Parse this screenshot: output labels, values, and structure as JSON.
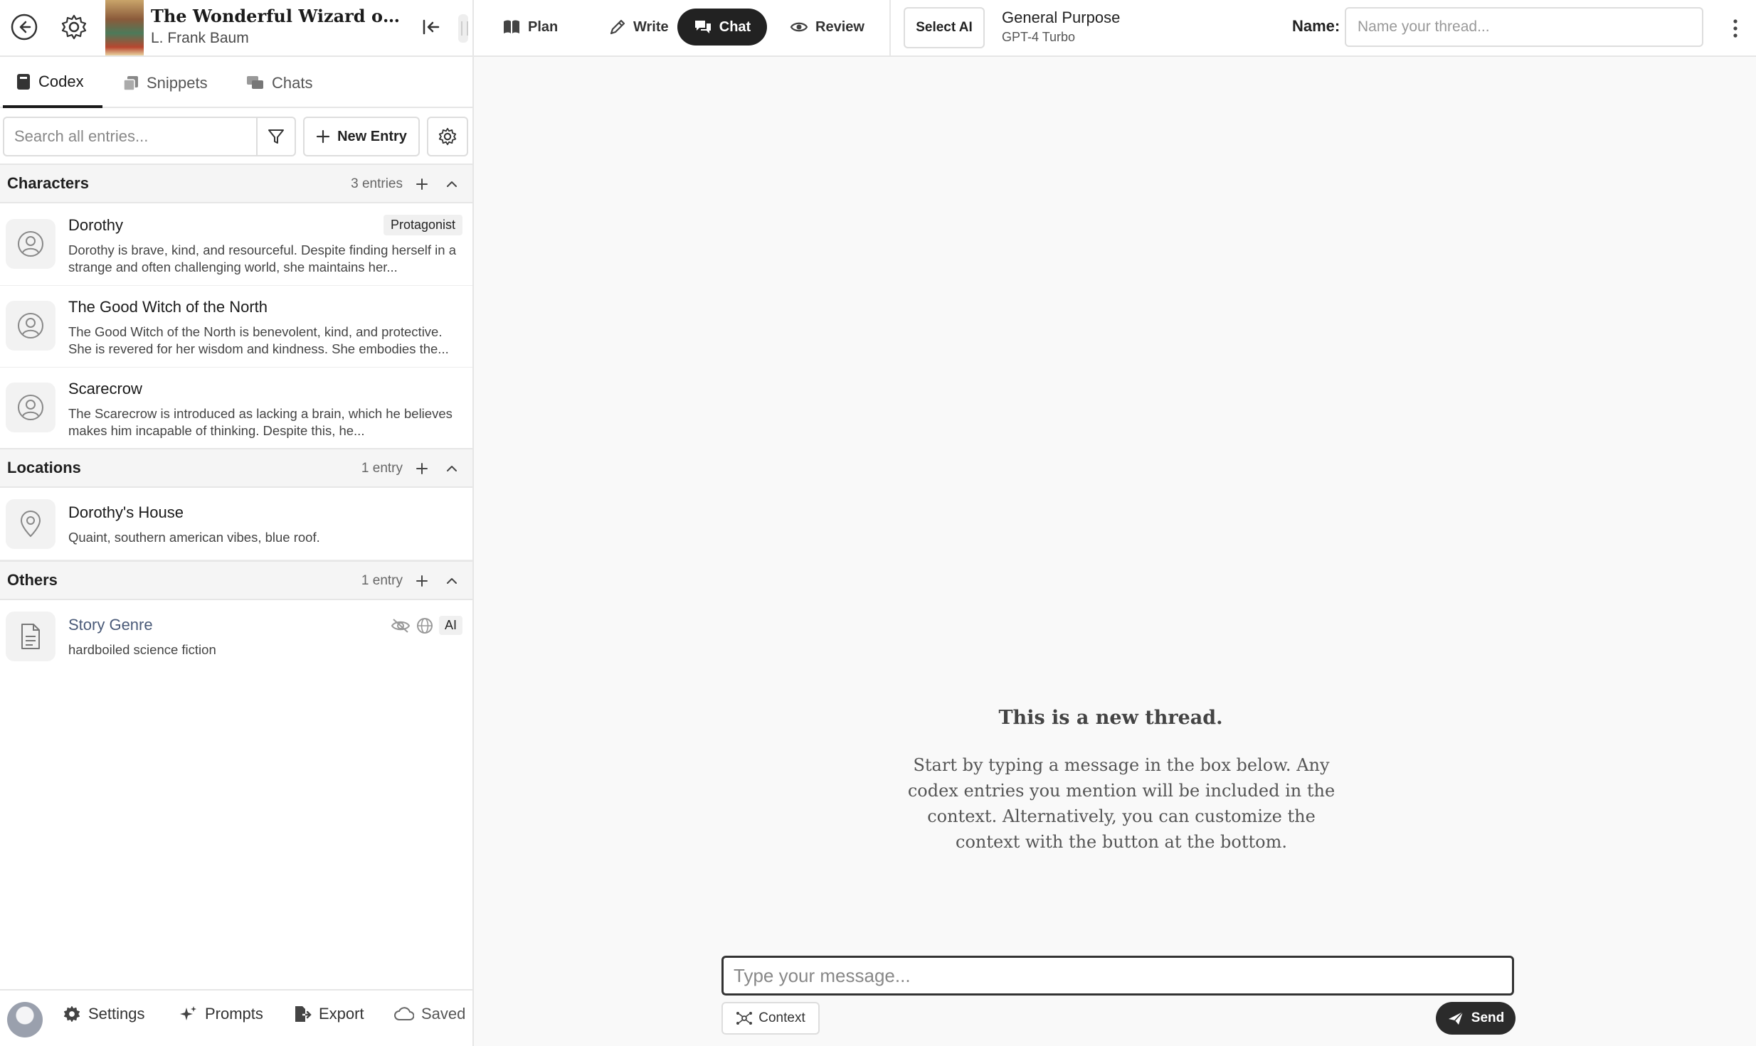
{
  "book": {
    "title": "The Wonderful Wizard of Oz...",
    "author": "L. Frank Baum"
  },
  "sidebar_tabs": [
    {
      "label": "Codex",
      "icon": "book-icon",
      "active": true
    },
    {
      "label": "Snippets",
      "icon": "snippets-icon",
      "active": false
    },
    {
      "label": "Chats",
      "icon": "chats-icon",
      "active": false
    }
  ],
  "search": {
    "placeholder": "Search all entries...",
    "new_entry_label": "New Entry"
  },
  "sections": {
    "characters": {
      "title": "Characters",
      "count": "3 entries"
    },
    "locations": {
      "title": "Locations",
      "count": "1 entry"
    },
    "others": {
      "title": "Others",
      "count": "1 entry"
    }
  },
  "entries": {
    "dorothy": {
      "name": "Dorothy",
      "badge": "Protagonist",
      "desc": "Dorothy is brave, kind, and resourceful. Despite finding herself in a strange and often challenging world, she maintains her..."
    },
    "good_witch": {
      "name": "The Good Witch of the North",
      "desc": "The Good Witch of the North is benevolent, kind, and protective. She is revered for her wisdom and kindness. She embodies the..."
    },
    "scarecrow": {
      "name": "Scarecrow",
      "desc": "The Scarecrow is introduced as lacking a brain, which he believes makes him incapable of thinking. Despite this, he..."
    },
    "dorothys_house": {
      "name": "Dorothy's House",
      "desc": "Quaint, southern american vibes, blue roof."
    },
    "story_genre": {
      "name": "Story Genre",
      "desc": "hardboiled science fiction",
      "ai_badge": "AI"
    }
  },
  "footer": {
    "settings": "Settings",
    "prompts": "Prompts",
    "export": "Export",
    "saved": "Saved"
  },
  "modes": {
    "plan": "Plan",
    "write": "Write",
    "chat": "Chat",
    "review": "Review",
    "active": "Chat"
  },
  "ai": {
    "select_label": "Select AI",
    "model_name": "General Purpose",
    "model_sub": "GPT-4 Turbo"
  },
  "thread": {
    "name_label": "Name:",
    "name_placeholder": "Name your thread..."
  },
  "empty_state": {
    "title": "This is a new thread.",
    "body": "Start by typing a message in the box below. Any codex entries you mention will be included in the context. Alternatively, you can customize the context with the button at the bottom."
  },
  "composer": {
    "placeholder": "Type your message...",
    "context_label": "Context",
    "send_label": "Send"
  },
  "colors": {
    "accent": "#222222",
    "background": "#f9f9f9",
    "border": "#e6e6e6"
  }
}
